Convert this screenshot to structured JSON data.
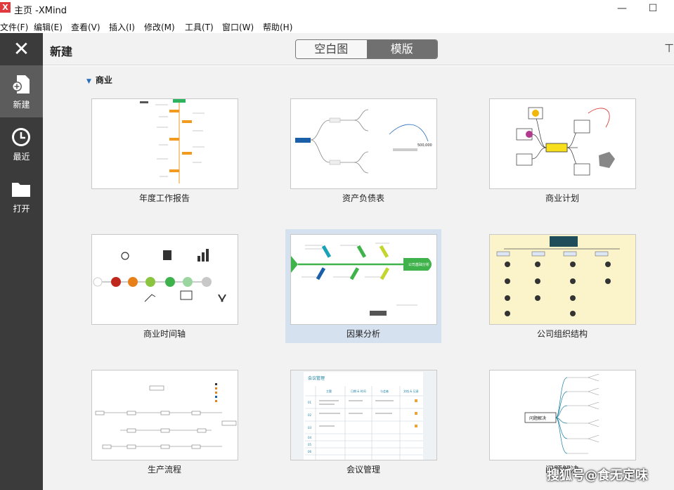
{
  "window": {
    "title": "主页 -XMind",
    "logo": "X",
    "minimize_icon": "minimize-icon",
    "maximize_icon": "maximize-icon"
  },
  "menubar": {
    "items": [
      "文件(F)",
      "编辑(E)",
      "查看(V)",
      "插入(I)",
      "修改(M)",
      "工具(T)",
      "窗口(W)",
      "帮助(H)"
    ]
  },
  "sidebar": {
    "close_icon": "close-icon",
    "items": [
      {
        "label": "新建",
        "icon": "new-file-icon",
        "active": true
      },
      {
        "label": "最近",
        "icon": "clock-icon",
        "active": false
      },
      {
        "label": "打开",
        "icon": "folder-icon",
        "active": false
      }
    ]
  },
  "topbar": {
    "title": "新建",
    "tabs": [
      "空白图",
      "模版"
    ],
    "active_tab": "模版"
  },
  "section": {
    "title": "商业"
  },
  "templates": [
    {
      "label": "年度工作报告"
    },
    {
      "label": "资产负债表"
    },
    {
      "label": "商业计划"
    },
    {
      "label": "商业时间轴"
    },
    {
      "label": "因果分析",
      "selected": true
    },
    {
      "label": "公司组织结构"
    },
    {
      "label": "生产流程"
    },
    {
      "label": "会议管理"
    },
    {
      "label": "问题解决"
    }
  ],
  "thumb_text": {
    "balance_value": "500,000",
    "fishbone_head": "公司基础分析",
    "meeting_title": "会议管理",
    "meeting_cols": [
      "主题",
      "日期 & 时间",
      "与会者",
      "文档 & 记录"
    ],
    "meeting_rows": [
      "01",
      "02",
      "03",
      "04",
      "05",
      "06"
    ],
    "problem_root": "问题解决"
  },
  "watermark": "搜狐号@食无定味",
  "colors": {
    "sidebar": "#3b3b3b",
    "sidebar_active": "#5c5c5c",
    "accent": "#2a6ebd",
    "selected": "#d5e1ef",
    "tab_active": "#707070"
  }
}
